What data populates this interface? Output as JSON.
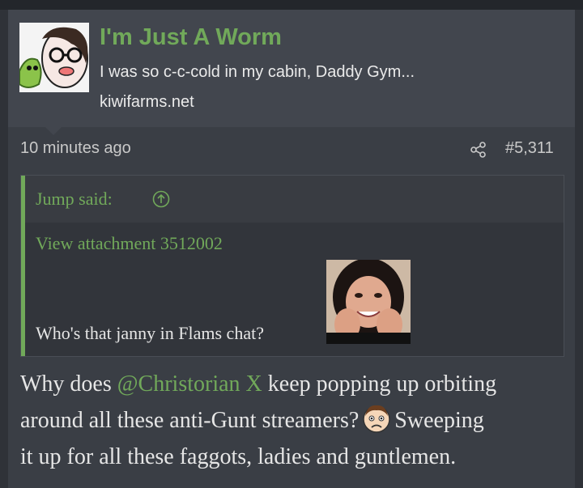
{
  "card": {
    "title": "I'm Just A Worm",
    "description": "I was so c-c-cold in my cabin, Daddy Gym...",
    "domain": "kiwifarms.net"
  },
  "post": {
    "timestamp": "10 minutes ago",
    "share_icon": "share-icon",
    "number": "#5,311"
  },
  "quote": {
    "author_said": "Jump said:",
    "up_icon": "arrow-up-circle-icon",
    "attachment_link": "View attachment 3512002",
    "text": "Who's that janny in Flams chat?"
  },
  "message": {
    "part1": "Why does ",
    "mention": "@Christorian X",
    "part2": " keep popping up orbiting",
    "line2": "around all these anti-Gunt streamers?",
    "emoji": "worried-face-emoji",
    "line2b": "Sweeping",
    "line3": "it up for all these faggots, ladies and guntlemen."
  },
  "colors": {
    "accent": "#71a95a",
    "background": "#2f3238",
    "card": "#42464e",
    "text": "#e6e6e6"
  }
}
